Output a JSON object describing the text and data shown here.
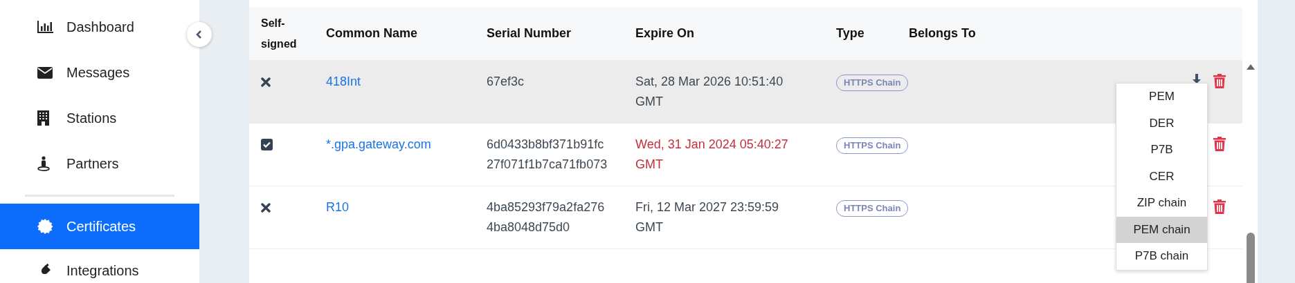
{
  "sidebar": {
    "items": [
      {
        "label": "Dashboard",
        "selected": false
      },
      {
        "label": "Messages",
        "selected": false
      },
      {
        "label": "Stations",
        "selected": false
      },
      {
        "label": "Partners",
        "selected": false
      },
      {
        "label": "Certificates",
        "selected": true
      },
      {
        "label": "Integrations",
        "selected": false
      }
    ]
  },
  "table": {
    "columns": [
      "Self-signed",
      "Common Name",
      "Serial Number",
      "Expire On",
      "Type",
      "Belongs To"
    ],
    "rows": [
      {
        "self_signed": false,
        "common_name": "418Int",
        "serial_number": "67ef3c",
        "expire_on": "Sat, 28 Mar 2026 10:51:40 GMT",
        "expired": false,
        "type": "HTTPS Chain",
        "highlighted": true
      },
      {
        "self_signed": true,
        "common_name": "*.gpa.gateway.com",
        "serial_number": "6d0433b8bf371b91fc27f071f1b7ca71fb073",
        "expire_on": "Wed, 31 Jan 2024 05:40:27 GMT",
        "expired": true,
        "type": "HTTPS Chain",
        "highlighted": false
      },
      {
        "self_signed": false,
        "common_name": "R10",
        "serial_number": "4ba85293f79a2fa2764ba8048d75d0",
        "expire_on": "Fri, 12 Mar 2027 23:59:59 GMT",
        "expired": false,
        "type": "HTTPS Chain",
        "highlighted": false
      }
    ]
  },
  "export_menu": {
    "items": [
      {
        "label": "PEM",
        "selected": false
      },
      {
        "label": "DER",
        "selected": false
      },
      {
        "label": "P7B",
        "selected": false
      },
      {
        "label": "CER",
        "selected": false
      },
      {
        "label": "ZIP chain",
        "selected": false
      },
      {
        "label": "PEM chain",
        "selected": true
      },
      {
        "label": "P7B chain",
        "selected": false
      }
    ]
  }
}
